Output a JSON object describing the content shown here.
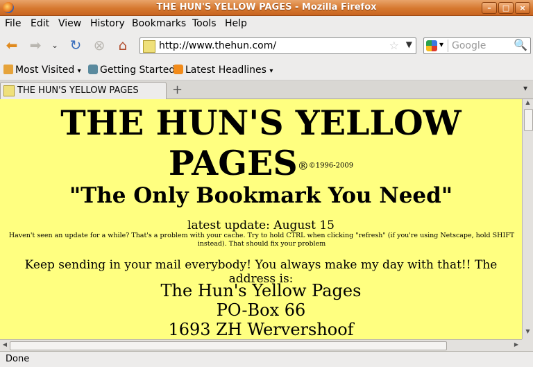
{
  "window": {
    "title": "THE HUN'S YELLOW PAGES - Mozilla Firefox"
  },
  "menu": [
    "File",
    "Edit",
    "View",
    "History",
    "Bookmarks",
    "Tools",
    "Help"
  ],
  "toolbar": {
    "url": "http://www.thehun.com/",
    "search_placeholder": "Google"
  },
  "bookmarks": [
    "Most Visited",
    "Getting Started",
    "Latest Headlines"
  ],
  "tab": {
    "title": "THE HUN'S YELLOW PAGES"
  },
  "page": {
    "title_line1": "THE HUN'S YELLOW",
    "title_line2": "PAGES",
    "registered": "®",
    "copyright": "©1996-2009",
    "tagline": "\"The Only Bookmark You Need\"",
    "latest_update": "latest update: August 15",
    "cache_note": "Haven't seen an update for a while? That's a problem with your cache. Try to hold CTRL when clicking \"refresh\" (if you're using Netscape, hold SHIFT instead). That should fix your problem",
    "mail_note": "Keep sending in your mail everybody! You always make my day with that!! The address is:",
    "address": [
      "The Hun's Yellow Pages",
      "PO-Box 66",
      "1693 ZH Wervershoof"
    ]
  },
  "status": "Done"
}
